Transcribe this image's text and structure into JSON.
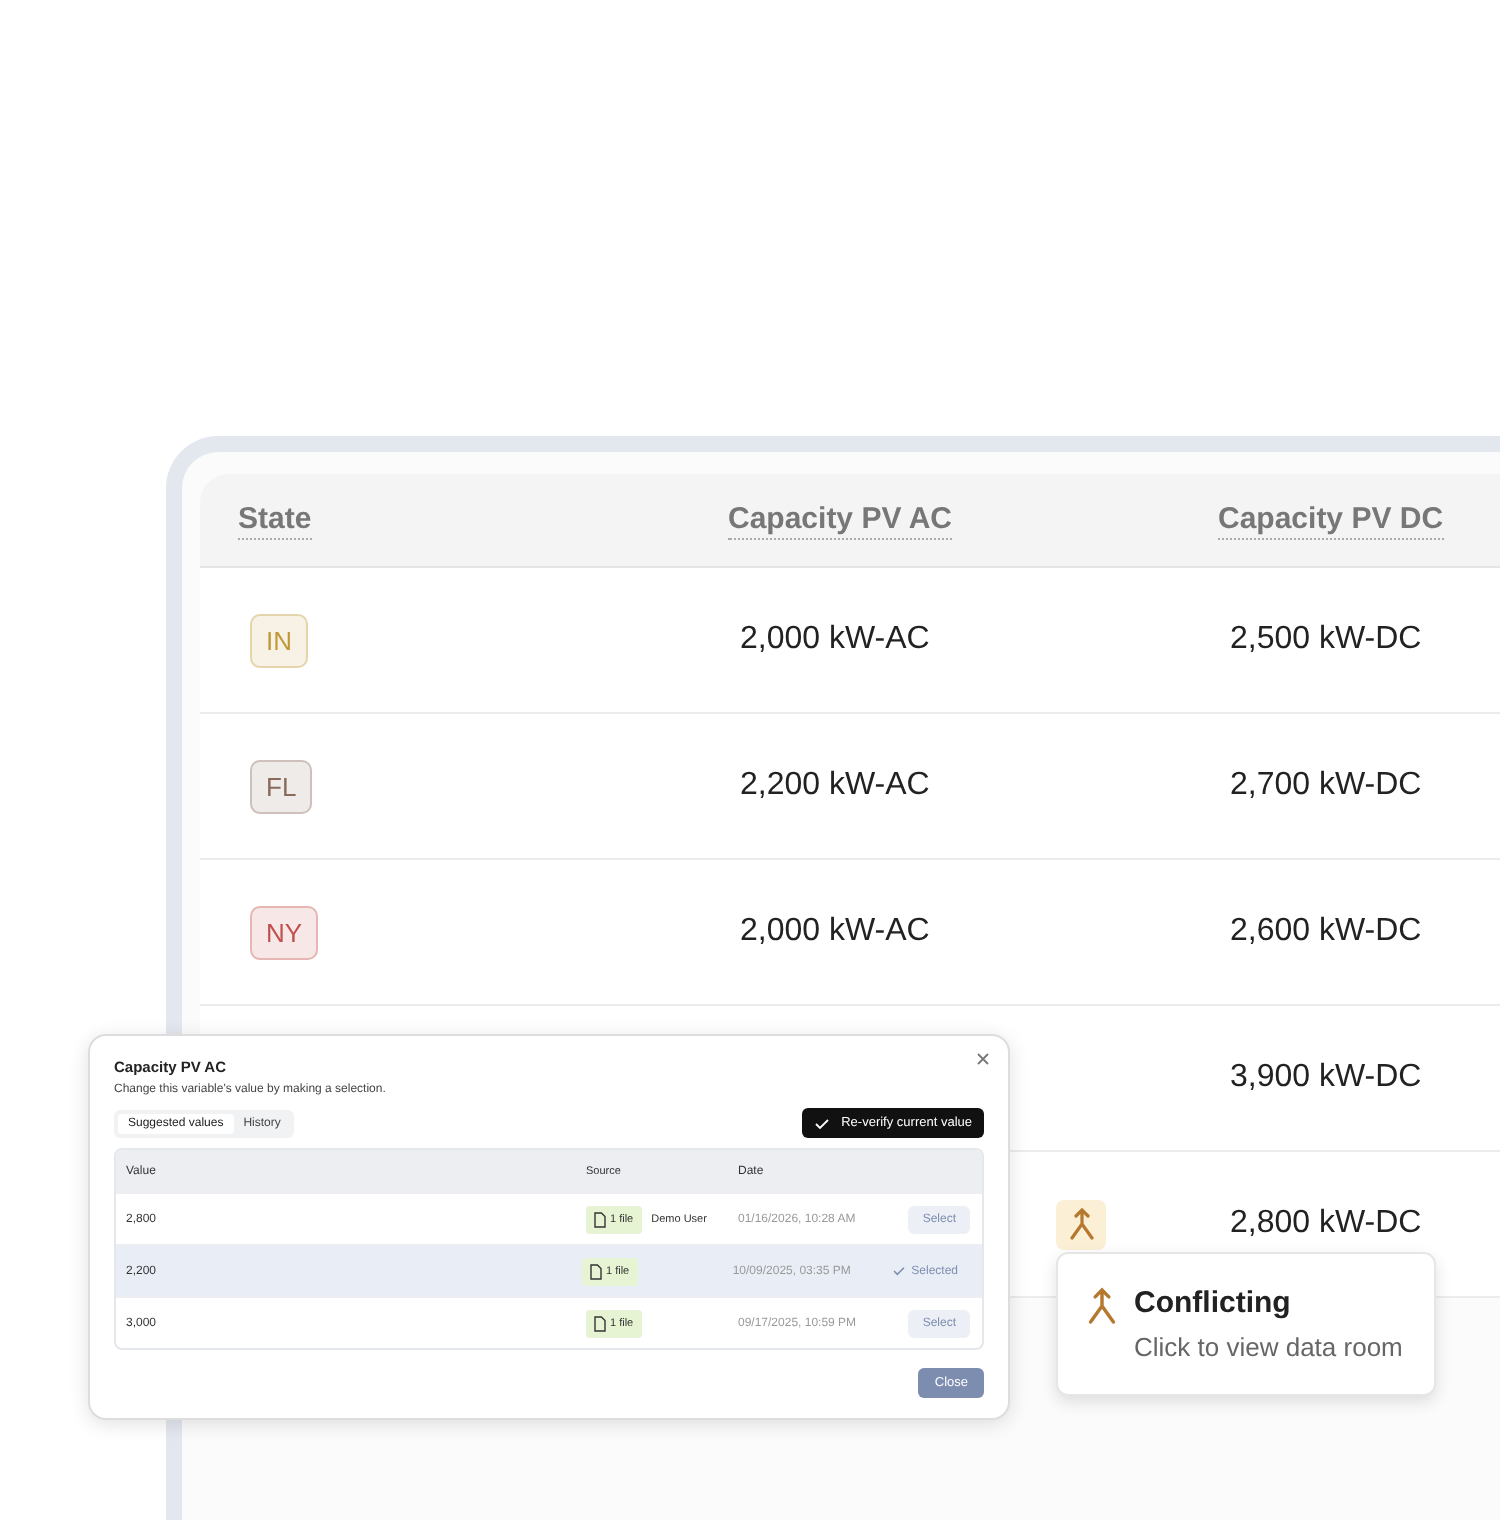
{
  "table": {
    "columns": [
      {
        "label": "State"
      },
      {
        "label": "Capacity PV AC"
      },
      {
        "label": "Capacity PV DC"
      }
    ],
    "rows": [
      {
        "state": "IN",
        "color": "#c09a3a",
        "ac": "2,000 kW-AC",
        "dc": "2,500 kW-DC",
        "conflicting": false
      },
      {
        "state": "FL",
        "color": "#8a6a5a",
        "ac": "2,200 kW-AC",
        "dc": "2,700 kW-DC",
        "conflicting": false
      },
      {
        "state": "NY",
        "color": "#c0504d",
        "ac": "2,000 kW-AC",
        "dc": "2,600 kW-DC",
        "conflicting": false
      },
      {
        "dc": "3,900 kW-DC",
        "conflicting": false
      },
      {
        "dc": "2,800 kW-DC",
        "conflicting": true
      }
    ]
  },
  "tooltip": {
    "title": "Conflicting",
    "text": "Click to view data room"
  },
  "dialog": {
    "title": "Capacity PV AC",
    "subtitle": "Change this variable's value by making a selection.",
    "tabs": [
      {
        "label": "Suggested values",
        "selected": true
      },
      {
        "label": "History",
        "selected": false
      }
    ],
    "reverify_button": "Re-verify current value",
    "columns": [
      "Value",
      "Source",
      "Date"
    ],
    "rows": [
      {
        "value": "2,800",
        "file": "1 file",
        "user": "Demo User",
        "date": "01/16/2026, 10:28 AM",
        "action": "Select",
        "selected": false
      },
      {
        "value": "2,200",
        "file": "1 file",
        "date": "10/09/2025, 03:35 PM",
        "action": "Selected",
        "selected": true
      },
      {
        "value": "3,000",
        "file": "1 file",
        "date": "09/17/2025, 10:59 PM",
        "action": "Select",
        "selected": false
      }
    ],
    "close_button": "Close"
  }
}
